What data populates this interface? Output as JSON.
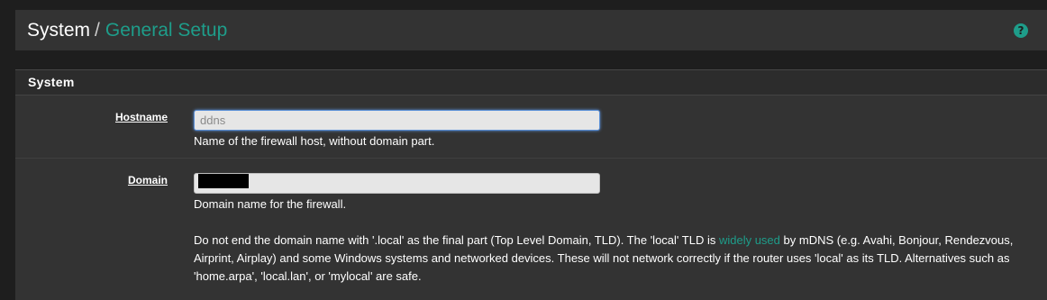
{
  "header": {
    "breadcrumb_root": "System",
    "breadcrumb_separator": "/",
    "breadcrumb_current": "General Setup",
    "help_icon": "question-circle-icon",
    "help_glyph": "?"
  },
  "panel": {
    "title": "System",
    "hostname": {
      "label": "Hostname",
      "placeholder": "ddns",
      "help": "Name of the firewall host, without domain part."
    },
    "domain": {
      "label": "Domain",
      "help": "Domain name for the firewall.",
      "note_before_link": "Do not end the domain name with '.local' as the final part (Top Level Domain, TLD). The 'local' TLD is",
      "note_link": "widely used",
      "note_after_link": "by mDNS (e.g. Avahi, Bonjour, Rendezvous, Airprint, Airplay) and some Windows systems and networked devices. These will not network correctly if the router uses 'local' as its TLD. Alternatives such as 'home.arpa', 'local.lan', or 'mylocal' are safe."
    }
  },
  "colors": {
    "accent": "#1e9d8a",
    "background": "#1e1e1e",
    "panel": "#333333"
  }
}
